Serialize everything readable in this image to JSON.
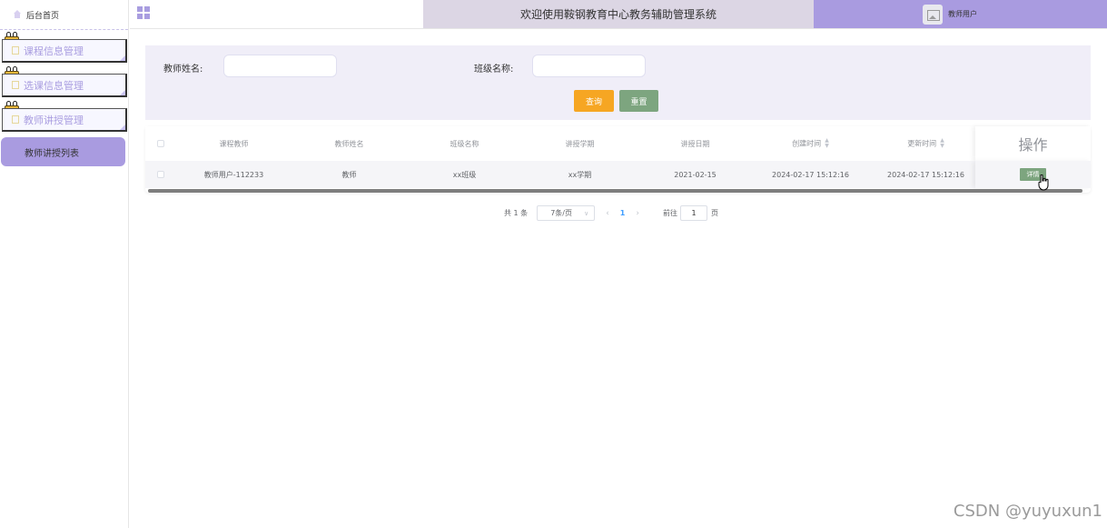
{
  "sidebar": {
    "home_label": "后台首页",
    "menus": [
      {
        "label": "课程信息管理"
      },
      {
        "label": "选课信息管理"
      },
      {
        "label": "教师讲授管理"
      }
    ],
    "active_submenu": "教师讲授列表"
  },
  "header": {
    "title": "欢迎使用鞍钢教育中心教务辅助管理系统",
    "user_label": "教师用户"
  },
  "search": {
    "teacher_name_label": "教师姓名:",
    "teacher_name_value": "",
    "class_name_label": "班级名称:",
    "class_name_value": "",
    "search_button": "查询",
    "reset_button": "重置"
  },
  "table": {
    "headers": [
      "课程教师",
      "教师姓名",
      "班级名称",
      "讲授学期",
      "讲授日期",
      "创建时间",
      "更新时间",
      "操作"
    ],
    "rows": [
      {
        "course_teacher": "教师用户-112233",
        "teacher_name": "教师",
        "class_name": "xx班级",
        "term": "xx学期",
        "date": "2021-02-15",
        "created": "2024-02-17 15:12:16",
        "updated": "2024-02-17 15:12:16",
        "action": "详情"
      }
    ]
  },
  "pagination": {
    "total": "共 1 条",
    "page_size": "7条/页",
    "current_page": "1",
    "goto_label": "前往",
    "goto_value": "1",
    "page_suffix": "页"
  },
  "watermark": "CSDN @yuyuxun1",
  "colors": {
    "accent": "#a99be0",
    "title_bg": "#dcd6e4",
    "search_btn": "#f6a623",
    "reset_btn": "#7da57f",
    "panel_bg": "#f0eef8"
  }
}
